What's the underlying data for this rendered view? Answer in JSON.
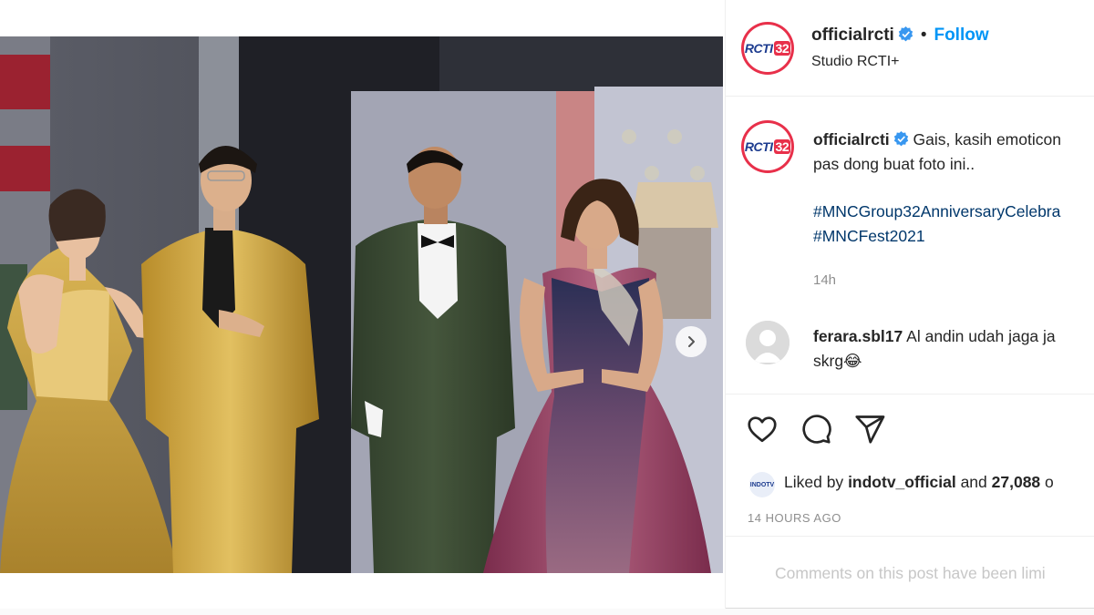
{
  "post": {
    "username": "officialrcti",
    "separator": "•",
    "follow_label": "Follow",
    "location": "Studio RCTI+",
    "avatar_logo": {
      "brand": "RCTI",
      "number": "32"
    },
    "caption": {
      "line1": "Gais, kasih emoticon",
      "line2": "pas dong buat foto ini..",
      "hashtag1": "#MNCGroup32AnniversaryCelebra",
      "hashtag2": "#MNCFest2021"
    },
    "caption_age": "14h",
    "comment": {
      "username": "ferara.sbl17",
      "text_line1": "Al andin udah jaga ja",
      "text_line2": "skrg😂"
    },
    "liked_by": {
      "prefix": "Liked by",
      "user": "indotv_official",
      "suffix": "and",
      "count": "27,088",
      "tail": "o"
    },
    "timestamp": "14 HOURS AGO",
    "comments_limited": "Comments on this post have been limi",
    "carousel": {
      "total": 2,
      "current": 1
    },
    "icons": [
      "verified-badge-icon",
      "heart-icon",
      "comment-icon",
      "share-icon",
      "chevron-right-icon"
    ]
  },
  "colors": {
    "follow": "#0095f6",
    "verified": "#3897f0",
    "hashtag": "#00376b",
    "muted": "#8e8e8e",
    "avatar_ring": "#e8304a"
  }
}
